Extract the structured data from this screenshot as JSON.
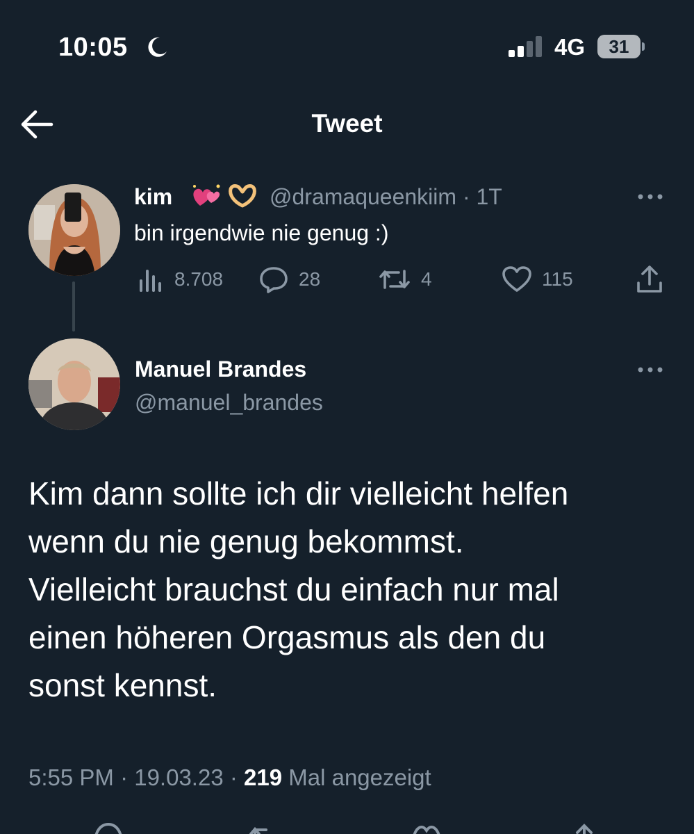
{
  "status_bar": {
    "time": "10:05",
    "network": "4G",
    "battery": "31",
    "icons": [
      "moon-icon",
      "signal-icon",
      "battery-icon"
    ]
  },
  "header": {
    "title": "Tweet",
    "back_icon": "arrow-left-icon"
  },
  "parent_tweet": {
    "name": "kim",
    "emojis": [
      "sparkling-hearts-emoji",
      "heart-hands-emoji"
    ],
    "handle_time": "@dramaqueenkiim · 1T",
    "text": "bin irgendwie nie genug :)",
    "stats": {
      "views": "8.708",
      "replies": "28",
      "retweets": "4",
      "likes": "115"
    }
  },
  "main_tweet": {
    "name": "Manuel Brandes",
    "handle": "@manuel_brandes",
    "text_lines": [
      "Kim dann sollte ich dir vielleicht helfen",
      "wenn du nie genug bekommst.",
      "Vielleicht brauchst du einfach nur mal",
      "einen höheren Orgasmus als den du",
      "sonst kennst."
    ],
    "timestamp": "5:55 PM · 19.03.23 · ",
    "views_count": "219",
    "views_label": " Mal angezeigt"
  },
  "colors": {
    "background": "#15202b",
    "text": "#ffffff",
    "secondary": "#8b98a5",
    "divider": "#38444d"
  }
}
